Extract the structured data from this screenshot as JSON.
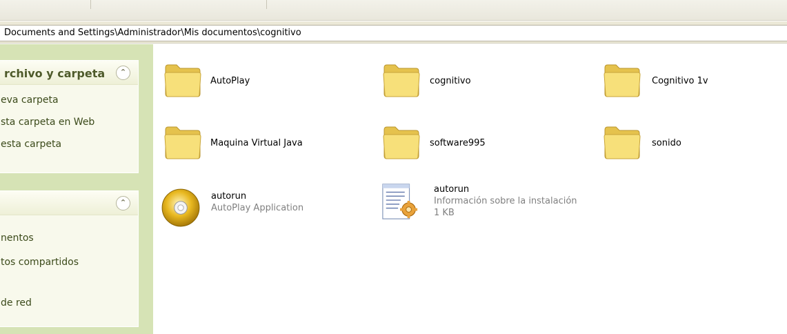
{
  "address": {
    "path": "Documents and Settings\\Administrador\\Mis documentos\\cognitivo"
  },
  "task_pane": {
    "panel1": {
      "title": "rchivo y carpeta",
      "links": [
        "eva carpeta",
        "sta carpeta en Web",
        " esta carpeta"
      ]
    },
    "panel2": {
      "links": [
        "nentos",
        "tos compartidos",
        "de red"
      ]
    }
  },
  "files": [
    {
      "name": "AutoPlay",
      "type": "folder"
    },
    {
      "name": "cognitivo",
      "type": "folder"
    },
    {
      "name": "Cognitivo 1v",
      "type": "folder"
    },
    {
      "name": "Maquina Virtual Java",
      "type": "folder"
    },
    {
      "name": "software995",
      "type": "folder"
    },
    {
      "name": "sonido",
      "type": "folder"
    },
    {
      "name": "autorun",
      "detail": "AutoPlay Application",
      "type": "application"
    },
    {
      "name": "autorun",
      "detail": "Información sobre la instalación",
      "size": "1 KB",
      "type": "setup-info"
    }
  ],
  "icons": {
    "folder": "folder-icon",
    "application": "cd-icon",
    "setup-info": "setup-information-icon"
  },
  "colors": {
    "task_pane_bg": "#d6e3b5",
    "panel_bg": "#f8f9ec",
    "panel_title": "#4e5a2a",
    "folder_front": "#f7e07a",
    "folder_back": "#e5c24d"
  }
}
